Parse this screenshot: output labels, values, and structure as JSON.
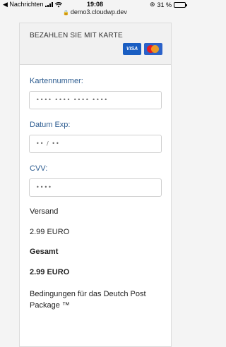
{
  "status": {
    "back_app": "◀ Nachrichten",
    "time": "19:08",
    "battery_percent": "31 %",
    "battery_level": 0.31
  },
  "browser": {
    "url": "demo3.cloudwp.dev"
  },
  "payment": {
    "title": "BEZAHLEN SIE MIT KARTE",
    "card_brands": [
      "VISA",
      "mastercard"
    ],
    "visa_label": "VISA",
    "card_number_label": "Kartennummer:",
    "card_number_placeholder": "•••• •••• •••• ••••",
    "expiry_label": "Datum Exp:",
    "expiry_placeholder": "•• / ••",
    "cvv_label": "CVV:",
    "cvv_placeholder": "••••"
  },
  "summary": {
    "shipping_label": "Versand",
    "shipping_value": "2.99 EURO",
    "total_label": "Gesamt",
    "total_value": "2.99 EURO",
    "terms": "Bedingungen für das Deutch Post Package ™"
  },
  "colors": {
    "label_blue": "#2e5d91",
    "visa_blue": "#1a5ec2",
    "battery_yellow": "#f2c200"
  }
}
